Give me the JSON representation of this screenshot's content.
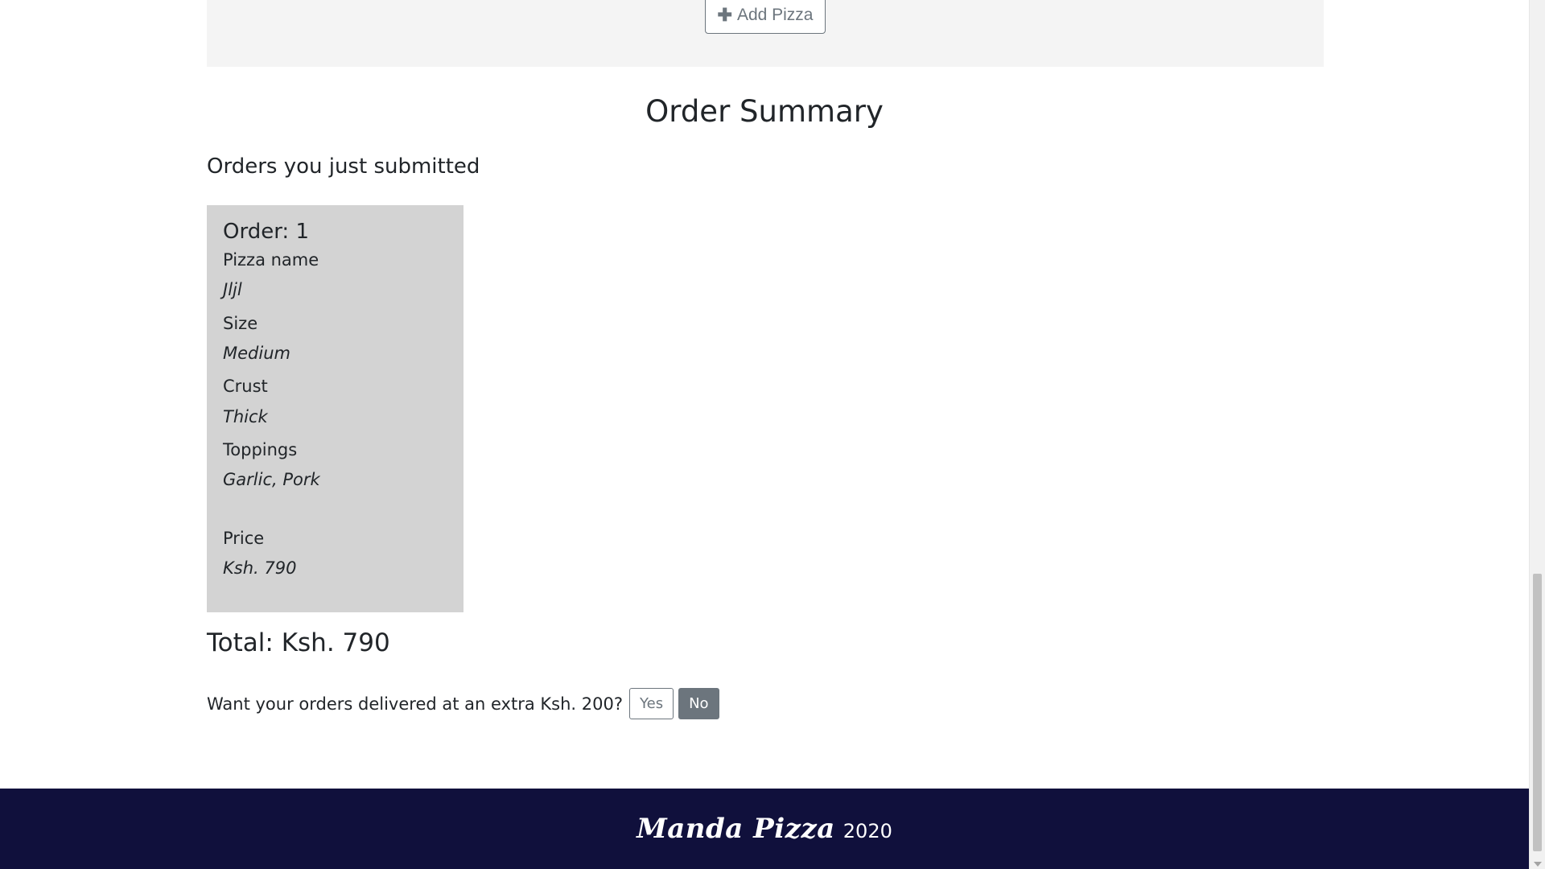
{
  "form": {
    "add_pizza_label": "Add Pizza"
  },
  "summary": {
    "title": "Order Summary",
    "subtitle": "Orders you just submitted",
    "order": {
      "heading": "Order: 1",
      "pizza_name_label": "Pizza name",
      "pizza_name_value": "Jljl",
      "size_label": "Size",
      "size_value": "Medium",
      "crust_label": "Crust",
      "crust_value": "Thick",
      "toppings_label": "Toppings",
      "toppings_value": "Garlic, Pork",
      "price_label": "Price",
      "price_value": "Ksh. 790"
    },
    "total": "Total: Ksh. 790",
    "delivery_question": "Want your orders delivered at an extra Ksh. 200?",
    "yes_label": "Yes",
    "no_label": "No"
  },
  "footer": {
    "brand": "Manda Pizza",
    "year": "2020"
  },
  "icons": {
    "add": "plus-icon"
  },
  "colors": {
    "footer_bg": "#10103c",
    "card_bg": "#d3d3d3",
    "secondary": "#6c757d"
  }
}
